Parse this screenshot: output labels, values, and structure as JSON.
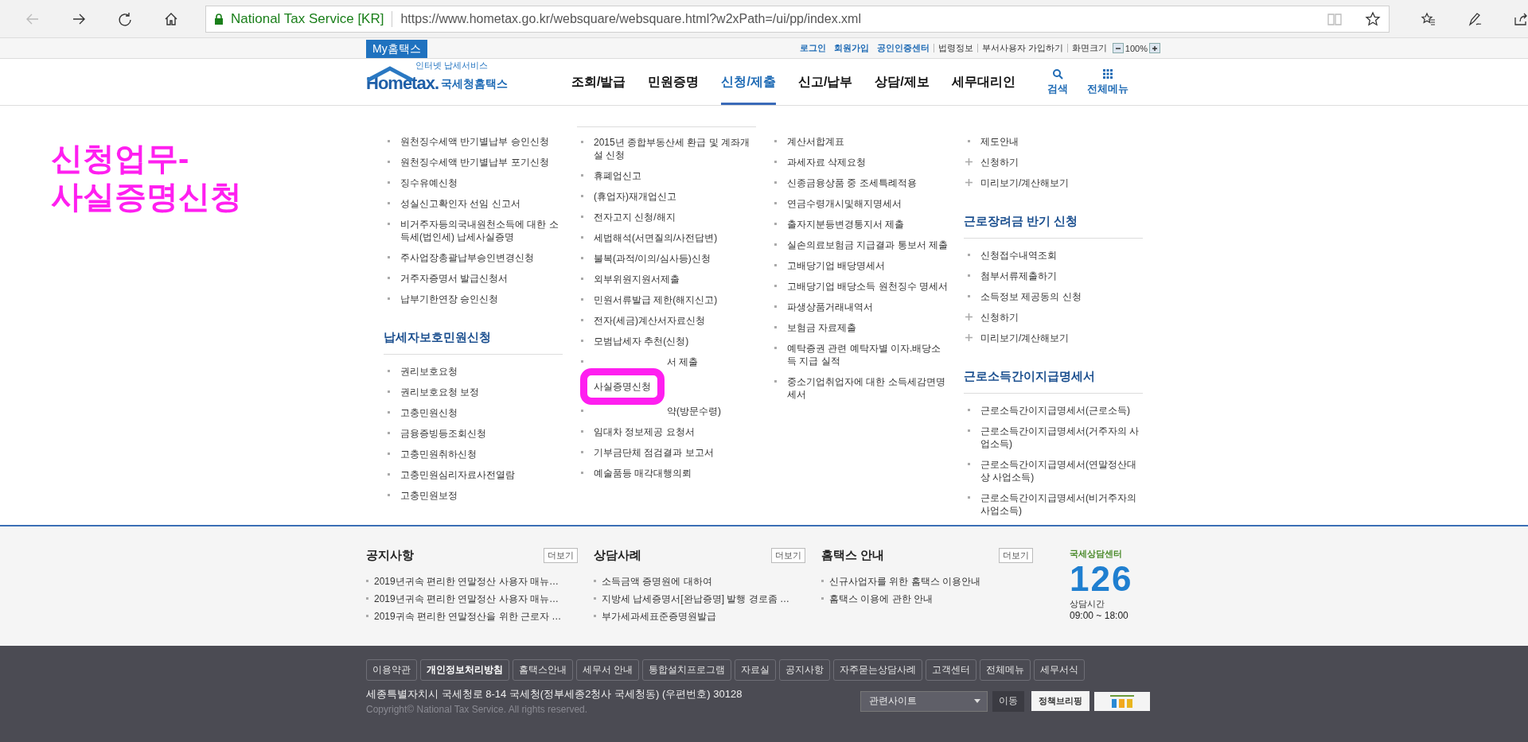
{
  "browser": {
    "site_identity": "National Tax Service [KR]",
    "url": "https://www.hometax.go.kr/websquare/websquare.html?w2xPath=/ui/pp/index.xml"
  },
  "topbar": {
    "my_tab": "My홈택스",
    "links": [
      {
        "text": "로그인",
        "emphasis": true
      },
      {
        "text": "회원가입",
        "emphasis": true
      },
      {
        "text": "공인인증센터",
        "emphasis": true
      },
      {
        "text": "법령정보",
        "emphasis": false
      },
      {
        "text": "부서사용자 가입하기",
        "emphasis": false
      },
      {
        "text": "화면크기",
        "emphasis": false
      }
    ],
    "zoom_value": "100%"
  },
  "header": {
    "logo": {
      "tagline": "인터넷 납세서비스",
      "brand": "Hometax.",
      "name": "국세청홈택스"
    },
    "nav": [
      {
        "label": "조회/발급",
        "selected": false
      },
      {
        "label": "민원증명",
        "selected": false
      },
      {
        "label": "신청/제출",
        "selected": true
      },
      {
        "label": "신고/납부",
        "selected": false
      },
      {
        "label": "상담/제보",
        "selected": false
      },
      {
        "label": "세무대리인",
        "selected": false
      }
    ],
    "tools": [
      {
        "kind": "search",
        "label": "검색"
      },
      {
        "kind": "grid",
        "label": "전체메뉴"
      }
    ]
  },
  "annotation": {
    "lines": [
      "신청업무-",
      "사실증명신청"
    ]
  },
  "menu": {
    "columns": [
      {
        "divider_above": false,
        "blocks": [
          {
            "items": [
              {
                "text": "원천징수세액 반기별납부 승인신청",
                "kind": "bullet"
              },
              {
                "text": "원천징수세액 반기별납부 포기신청",
                "kind": "bullet"
              },
              {
                "text": "징수유예신청",
                "kind": "bullet"
              },
              {
                "text": "성실신고확인자 선임 신고서",
                "kind": "bullet"
              },
              {
                "text": "비거주자등의국내원천소득에 대한 소득세(법인세) 납세사실증명",
                "kind": "bullet"
              },
              {
                "text": "주사업장총괄납부승인변경신청",
                "kind": "bullet"
              },
              {
                "text": "거주자증명서 발급신청서",
                "kind": "bullet"
              },
              {
                "text": "납부기한연장 승인신청",
                "kind": "bullet"
              }
            ]
          },
          {
            "heading": "납세자보호민원신청",
            "items": [
              {
                "text": "권리보호요청",
                "kind": "bullet"
              },
              {
                "text": "권리보호요청 보정",
                "kind": "bullet"
              },
              {
                "text": "고충민원신청",
                "kind": "bullet"
              },
              {
                "text": "금융증빙등조회신청",
                "kind": "bullet"
              },
              {
                "text": "고충민원취하신청",
                "kind": "bullet"
              },
              {
                "text": "고충민원심리자료사전열람",
                "kind": "bullet"
              },
              {
                "text": "고충민원보정",
                "kind": "bullet"
              }
            ]
          }
        ]
      },
      {
        "divider_above": true,
        "blocks": [
          {
            "items": [
              {
                "text": "2015년 종합부동산세 환급 및 계좌개설 신청",
                "kind": "bullet"
              },
              {
                "text": "휴폐업신고",
                "kind": "bullet"
              },
              {
                "text": "(휴업자)재개업신고",
                "kind": "bullet"
              },
              {
                "text": "전자고지 신청/해지",
                "kind": "bullet"
              },
              {
                "text": "세법해석(서면질의/사전답변)",
                "kind": "bullet"
              },
              {
                "text": "불복(과적/이의/심사등)신청",
                "kind": "bullet"
              },
              {
                "text": "외부위원지원서제출",
                "kind": "bullet"
              },
              {
                "text": "민원서류발급 제한(해지신고)",
                "kind": "bullet"
              },
              {
                "text": "전자(세금)계산서자료신청",
                "kind": "bullet"
              },
              {
                "text": "모범납세자 추천(신청)",
                "kind": "bullet"
              },
              {
                "text": "서 제출",
                "kind": "covered"
              },
              {
                "text": "사실증명신청",
                "kind": "circled"
              },
              {
                "text": "약(방문수령)",
                "kind": "covered"
              },
              {
                "text": "임대차 정보제공 요청서",
                "kind": "bullet"
              },
              {
                "text": "기부금단체 점검결과 보고서",
                "kind": "bullet"
              },
              {
                "text": "예술품등 매각대행의뢰",
                "kind": "bullet"
              }
            ]
          }
        ]
      },
      {
        "divider_above": false,
        "blocks": [
          {
            "items": [
              {
                "text": "계산서합계표",
                "kind": "bullet"
              },
              {
                "text": "과세자료 삭제요청",
                "kind": "bullet"
              },
              {
                "text": "신종금융상품 중 조세특례적용",
                "kind": "bullet"
              },
              {
                "text": "연금수령개시및해지명세서",
                "kind": "bullet"
              },
              {
                "text": "출자지분등변경통지서 제출",
                "kind": "bullet"
              },
              {
                "text": "실손의료보험금 지급결과 통보서 제출",
                "kind": "bullet"
              },
              {
                "text": "고배당기업 배당명세서",
                "kind": "bullet"
              },
              {
                "text": "고배당기업 배당소득 원천징수 명세서",
                "kind": "bullet"
              },
              {
                "text": "파생상품거래내역서",
                "kind": "bullet"
              },
              {
                "text": "보험금 자료제출",
                "kind": "bullet"
              },
              {
                "text": "예탁증권 관련 예탁자별 이자.배당소득 지급 실적",
                "kind": "bullet"
              },
              {
                "text": "중소기업취업자에 대한 소득세감면명세서",
                "kind": "bullet"
              }
            ]
          }
        ]
      },
      {
        "divider_above": false,
        "blocks": [
          {
            "items": [
              {
                "text": "제도안내",
                "kind": "bullet"
              },
              {
                "text": "신청하기",
                "kind": "plus"
              },
              {
                "text": "미리보기/계산해보기",
                "kind": "plus"
              }
            ]
          },
          {
            "heading": "근로장려금 반기 신청",
            "items": [
              {
                "text": "신청접수내역조회",
                "kind": "bullet"
              },
              {
                "text": "첨부서류제출하기",
                "kind": "bullet"
              },
              {
                "text": "소득정보 제공동의 신청",
                "kind": "bullet"
              },
              {
                "text": "신청하기",
                "kind": "plus"
              },
              {
                "text": "미리보기/계산해보기",
                "kind": "plus"
              }
            ]
          },
          {
            "heading": "근로소득간이지급명세서",
            "items": [
              {
                "text": "근로소득간이지급명세서(근로소득)",
                "kind": "bullet"
              },
              {
                "text": "근로소득간이지급명세서(거주자의 사업소득)",
                "kind": "bullet"
              },
              {
                "text": "근로소득간이지급명세서(연말정산대상 사업소득)",
                "kind": "bullet"
              },
              {
                "text": "근로소득간이지급명세서(비거주자의 사업소득)",
                "kind": "bullet"
              }
            ]
          }
        ]
      }
    ]
  },
  "notices": [
    {
      "title": "공지사항",
      "more": "더보기",
      "items": [
        "2019년귀속 편리한 연말정산 사용자 매뉴…",
        "2019년귀속 편리한 연말정산 사용자 매뉴…",
        "2019귀속 편리한 연말정산을 위한 근로자 …"
      ]
    },
    {
      "title": "상담사례",
      "more": "더보기",
      "items": [
        "소득금액 증명원에 대하여",
        "지방세 납세증명서[완납증명] 발행 경로좀 …",
        "부가세과세표준증명원발급"
      ]
    },
    {
      "title": "홈택스 안내",
      "more": "더보기",
      "items": [
        "신규사업자를 위한 홈택스 이용안내",
        "홈택스 이용에 관한 안내"
      ]
    }
  ],
  "call_center": {
    "title": "국세상담센터",
    "number": "126",
    "hours_label": "상담시간",
    "hours": "09:00 ~ 18:00"
  },
  "footer": {
    "links": [
      {
        "text": "이용약관",
        "emphasis": false
      },
      {
        "text": "개인정보처리방침",
        "emphasis": true
      },
      {
        "text": "홈택스안내",
        "emphasis": false
      },
      {
        "text": "세무서 안내",
        "emphasis": false
      },
      {
        "text": "통합설치프로그램",
        "emphasis": false
      },
      {
        "text": "자료실",
        "emphasis": false
      },
      {
        "text": "공지사항",
        "emphasis": false
      },
      {
        "text": "자주묻는상담사례",
        "emphasis": false
      },
      {
        "text": "고객센터",
        "emphasis": false
      },
      {
        "text": "전체메뉴",
        "emphasis": false
      },
      {
        "text": "세무서식",
        "emphasis": false
      }
    ],
    "address": "세종특별자치시 국세청로 8-14 국세청(정부세종2청사 국세청동) (우편번호) 30128",
    "copyright": "Copyright© National Tax Service. All rights reserved.",
    "site_select": "관련사이트",
    "go": "이동",
    "banner": "정책브리핑"
  }
}
